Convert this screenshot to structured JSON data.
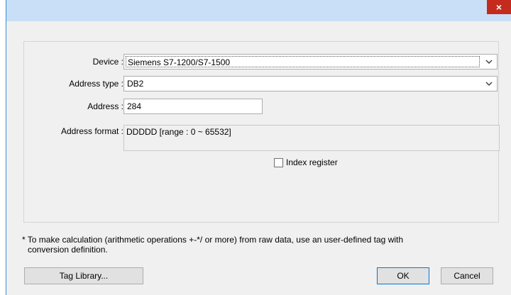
{
  "titlebar": {
    "close_label": "×"
  },
  "form": {
    "device_label": "Device :",
    "device_value": "Siemens S7-1200/S7-1500",
    "address_type_label": "Address type :",
    "address_type_value": "DB2",
    "address_label": "Address :",
    "address_value": "284",
    "address_format_label": "Address format :",
    "address_format_value": "DDDDD [range : 0 ~ 65532]",
    "index_register_label": "Index register",
    "index_register_checked": false
  },
  "note": {
    "line1": "* To make calculation (arithmetic operations +-*/ or more) from raw data, use an user-defined tag with",
    "line2": "conversion definition."
  },
  "buttons": {
    "tag_library": "Tag Library...",
    "ok": "OK",
    "cancel": "Cancel"
  }
}
